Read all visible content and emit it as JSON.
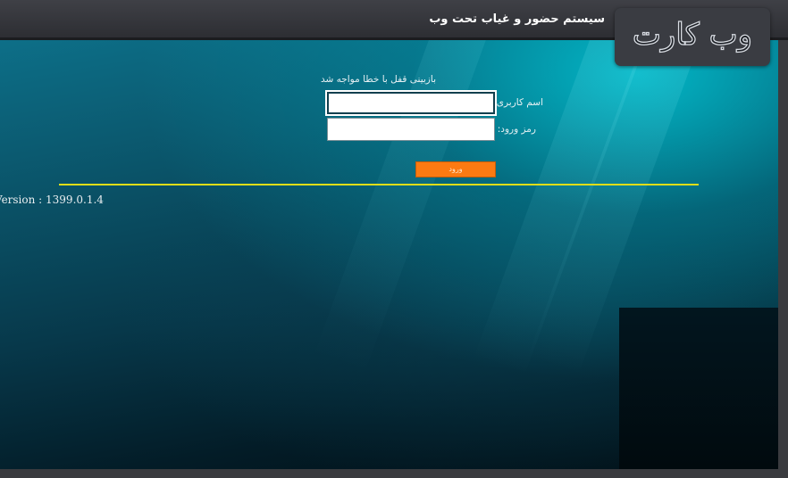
{
  "header": {
    "system_title": "سیستم حضور و غیاب تحت وب",
    "logo_text": "وب کارت"
  },
  "login": {
    "error_message": "بازبینی قفل با خطا مواجه شد",
    "username_label": "اسم کاربری:",
    "username_value": "",
    "password_label": "رمز ورود:",
    "password_value": "",
    "submit_label": "ورود"
  },
  "footer": {
    "version_text": "Version : 1399.0.1.4"
  },
  "colors": {
    "accent_button": "#fb7a12",
    "divider": "#e0de18",
    "background_teal": "#0a5166"
  }
}
